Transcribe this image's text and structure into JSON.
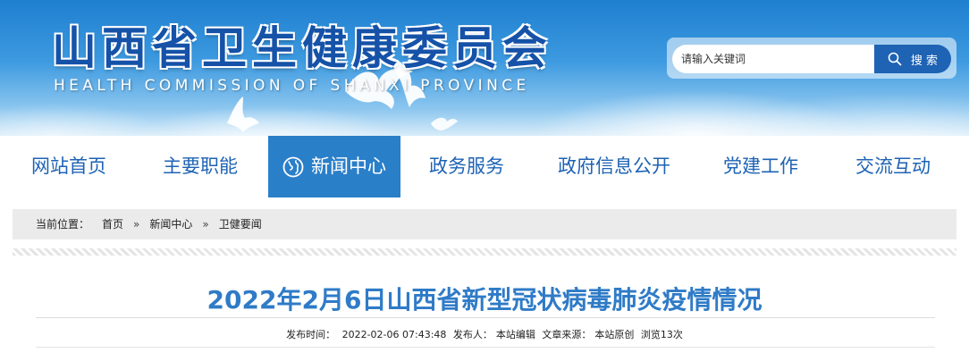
{
  "header": {
    "title_cn": "山西省卫生健康委员会",
    "title_en": "HEALTH COMMISSION OF SHANXI PROVINCE",
    "colors": {
      "brand_blue": "#1552a8",
      "accent_blue": "#2a7fc9",
      "title_blue": "#2f7bc7"
    }
  },
  "search": {
    "placeholder": "请输入关键词",
    "button_label": "搜 索",
    "icon": "search-icon"
  },
  "nav": {
    "items": [
      {
        "label": "网站首页"
      },
      {
        "label": "主要职能"
      },
      {
        "label": "新闻中心",
        "icon": "globe-icon",
        "active": true
      },
      {
        "label": "政务服务"
      },
      {
        "label": "政府信息公开"
      },
      {
        "label": "党建工作"
      },
      {
        "label": "交流互动"
      }
    ]
  },
  "breadcrumb": {
    "lead": "当前位置：",
    "items": [
      "首页",
      "新闻中心",
      "卫健要闻"
    ],
    "separator": "»"
  },
  "article": {
    "title": "2022年2月6日山西省新型冠状病毒肺炎疫情情况",
    "meta": {
      "published_label": "发布时间：",
      "published_value": "2022-02-06 07:43:48",
      "author_label": "发布人：",
      "author_value": "本站编辑",
      "source_label": "文章来源：",
      "source_value": "本站原创",
      "views": "浏览13次"
    }
  }
}
